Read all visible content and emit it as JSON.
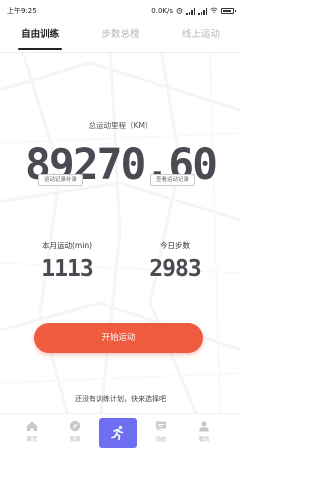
{
  "status_bar": {
    "time": "上午9:25",
    "network_speed": "0.0K/s"
  },
  "tabs": [
    {
      "label": "自由训练",
      "active": true
    },
    {
      "label": "步数总榜",
      "active": false
    },
    {
      "label": "线上运动",
      "active": false
    }
  ],
  "distance": {
    "label": "总运动里程（KM）",
    "value": "89270.60",
    "records_link": "运动记录补录",
    "view_records_link": "查看运动记录"
  },
  "stats": {
    "month_label": "本月运动(min)",
    "month_value": "1113",
    "steps_label": "今日步数",
    "steps_value": "2983"
  },
  "start_button": "开始运动",
  "plan_hint": "还没有训练计划，快来选择吧",
  "bottom_nav": [
    {
      "label": "首页",
      "icon": "home-icon"
    },
    {
      "label": "发现",
      "icon": "compass-icon"
    },
    {
      "label": "",
      "icon": "run-icon",
      "active": true
    },
    {
      "label": "动态",
      "icon": "chat-icon"
    },
    {
      "label": "我的",
      "icon": "user-icon"
    }
  ],
  "colors": {
    "accent": "#ee5b3f",
    "nav_active": "#6d6ff0",
    "number": "#4a4a52"
  }
}
